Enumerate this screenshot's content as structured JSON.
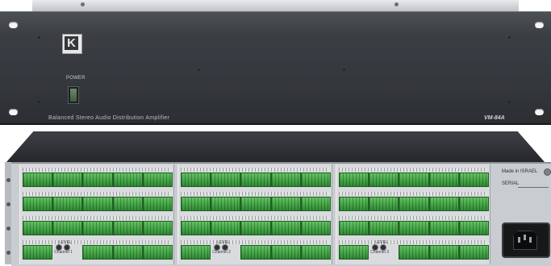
{
  "front_panel": {
    "logo_letter": "K",
    "power_label": "POWER",
    "caption": "Balanced Stereo Audio Distribution Amplifier",
    "model": "VM-84A"
  },
  "rear_panel": {
    "made_in": "Made in ISRAEL",
    "serial_label": "SERIAL",
    "level_label": "LEVEL",
    "channel_labels": [
      "Channel 1",
      "Channel 2",
      "Channel 3"
    ]
  },
  "colors": {
    "front_panel": "#3b3f44",
    "terminal_green": "#3fa444",
    "rear_panel": "#c9ccd0"
  }
}
